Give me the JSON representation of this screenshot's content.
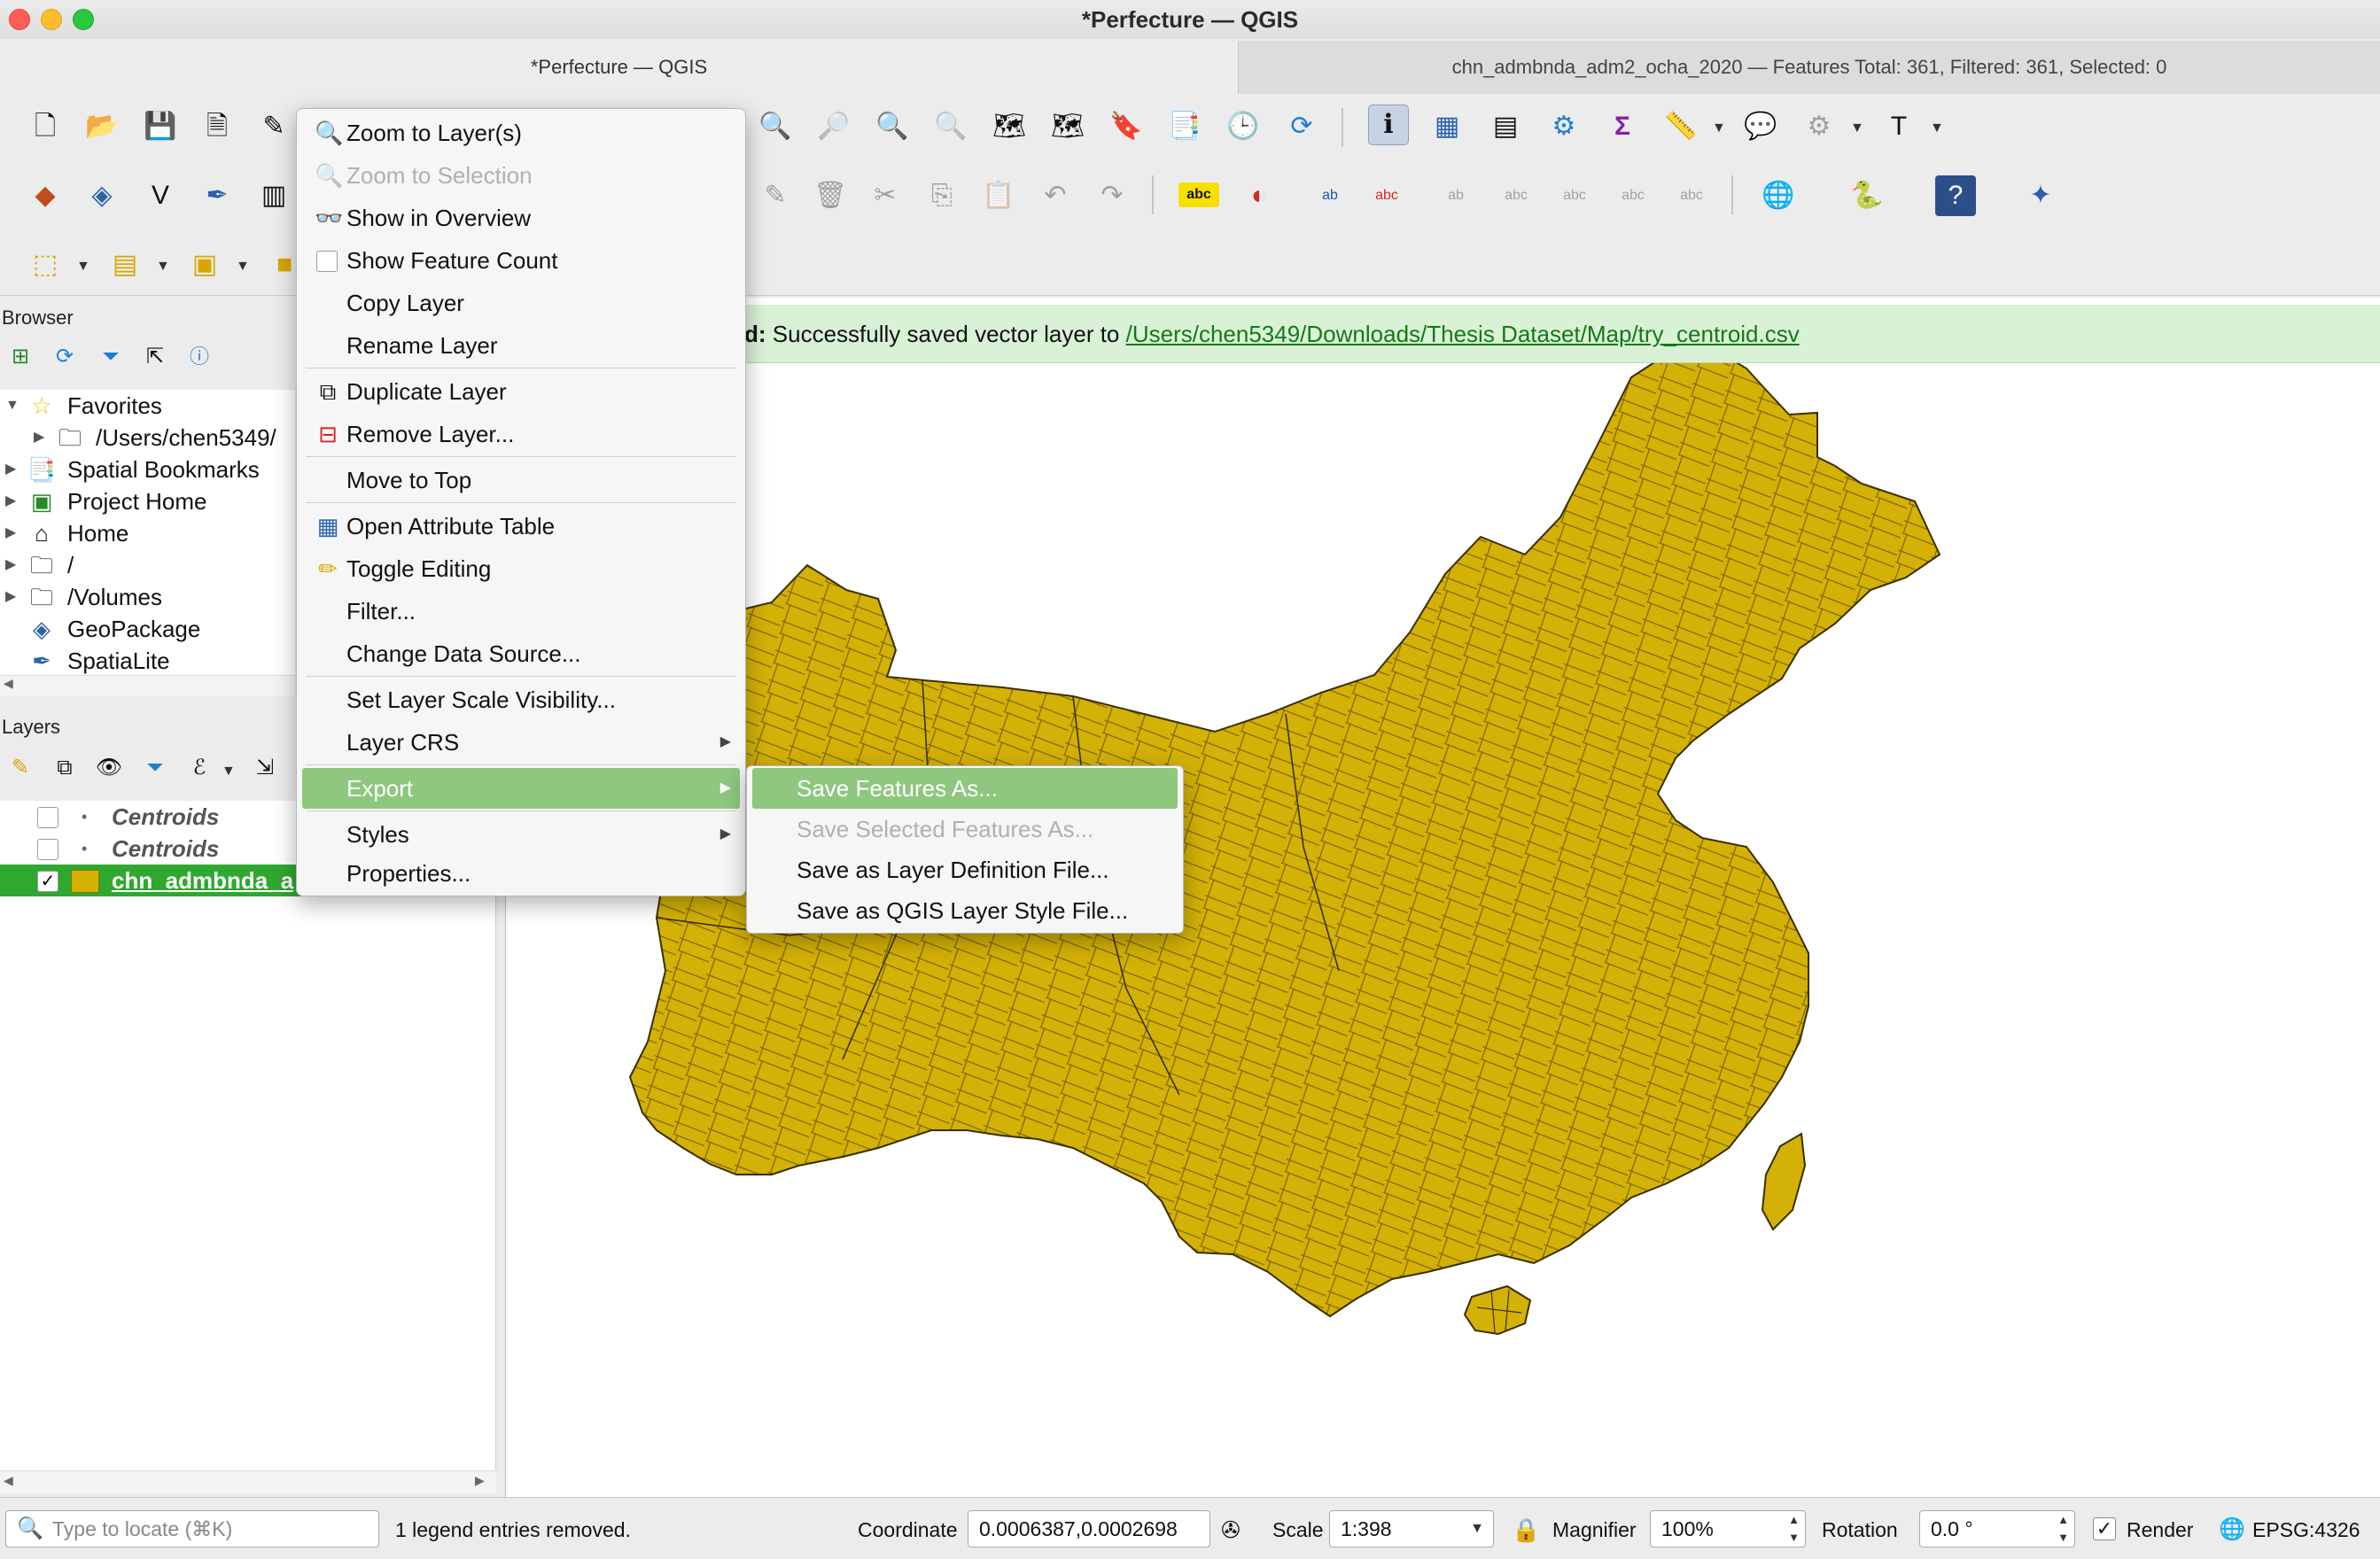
{
  "window": {
    "title": "*Perfecture — QGIS"
  },
  "tabs": [
    {
      "label": "*Perfecture — QGIS"
    },
    {
      "label": "chn_admbnda_adm2_ocha_2020 — Features Total: 361, Filtered: 361, Selected: 0"
    }
  ],
  "browser": {
    "title": "Browser",
    "items": [
      {
        "label": "Favorites",
        "icon": "star-icon"
      },
      {
        "label": "/Users/chen5349/",
        "icon": "folder-icon"
      },
      {
        "label": "Spatial Bookmarks",
        "icon": "bookmark-icon"
      },
      {
        "label": "Project Home",
        "icon": "project-home-icon"
      },
      {
        "label": "Home",
        "icon": "home-icon"
      },
      {
        "label": "/",
        "icon": "folder-icon"
      },
      {
        "label": "/Volumes",
        "icon": "folder-icon"
      },
      {
        "label": "GeoPackage",
        "icon": "geopackage-icon"
      },
      {
        "label": "SpatiaLite",
        "icon": "spatialite-icon"
      }
    ]
  },
  "layers": {
    "title": "Layers",
    "items": [
      {
        "name": "Centroids",
        "checked": false
      },
      {
        "name": "Centroids",
        "checked": false
      },
      {
        "name": "chn_admbnda_a",
        "checked": true,
        "color": "#d4b106"
      }
    ]
  },
  "message": {
    "prefix": "d:",
    "text": " Successfully saved vector layer to ",
    "link": "/Users/chen5349/Downloads/Thesis Dataset/Map/try_centroid.csv"
  },
  "context_menu": {
    "items": [
      {
        "label": "Zoom to Layer(s)"
      },
      {
        "label": "Zoom to Selection",
        "disabled": true
      },
      {
        "label": "Show in Overview"
      },
      {
        "label": "Show Feature Count"
      },
      {
        "label": "Copy Layer"
      },
      {
        "label": "Rename Layer"
      },
      {
        "label": "Duplicate Layer"
      },
      {
        "label": "Remove Layer..."
      },
      {
        "label": "Move to Top"
      },
      {
        "label": "Open Attribute Table"
      },
      {
        "label": "Toggle Editing"
      },
      {
        "label": "Filter..."
      },
      {
        "label": "Change Data Source..."
      },
      {
        "label": "Set Layer Scale Visibility..."
      },
      {
        "label": "Layer CRS"
      },
      {
        "label": "Export"
      },
      {
        "label": "Styles"
      },
      {
        "label": "Properties..."
      }
    ]
  },
  "export_submenu": {
    "items": [
      {
        "label": "Save Features As..."
      },
      {
        "label": "Save Selected Features As...",
        "disabled": true
      },
      {
        "label": "Save as Layer Definition File..."
      },
      {
        "label": "Save as QGIS Layer Style File..."
      }
    ]
  },
  "statusbar": {
    "locate_placeholder": "Type to locate (⌘K)",
    "message": "1 legend entries removed.",
    "coordinate_label": "Coordinate",
    "coordinate_value": "0.0006387,0.0002698",
    "scale_label": "Scale",
    "scale_value": "1:398",
    "magnifier_label": "Magnifier",
    "magnifier_value": "100%",
    "rotation_label": "Rotation",
    "rotation_value": "0.0 °",
    "render_label": "Render",
    "render_checked": true,
    "crs": "EPSG:4326"
  },
  "colors": {
    "map_fill": "#d4b106",
    "map_stroke": "#3a2f00",
    "highlight": "#8fc77f",
    "message_bg": "#d9f2d6",
    "layer_selected": "#2fa82f"
  }
}
